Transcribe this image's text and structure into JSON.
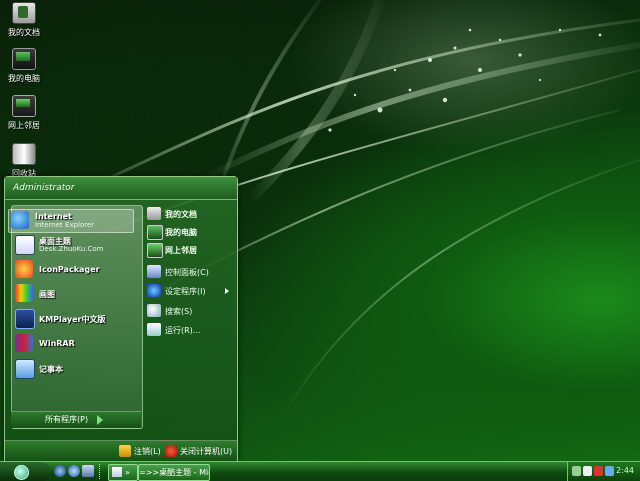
{
  "desktop": {
    "icons": [
      {
        "label": "我的文档",
        "icon": "my-documents-icon"
      },
      {
        "label": "我的电脑",
        "icon": "my-computer-icon"
      },
      {
        "label": "网上邻居",
        "icon": "network-places-icon"
      },
      {
        "label": "回收站",
        "icon": "recycle-bin-icon"
      }
    ]
  },
  "start_menu": {
    "user": "Administrator",
    "pinned": [
      {
        "title": "Internet",
        "subtitle": "Internet Explorer",
        "icon": "ie-icon"
      },
      {
        "title": "桌面主题",
        "subtitle": "Desk.ZhuoKu.Com",
        "icon": "desk-theme-icon"
      }
    ],
    "recent": [
      {
        "title": "IconPackager",
        "icon": "iconpackager-icon"
      },
      {
        "title": "画图",
        "icon": "paint-icon"
      },
      {
        "title": "KMPlayer中文版",
        "icon": "kmplayer-icon"
      },
      {
        "title": "WinRAR",
        "icon": "winrar-icon"
      },
      {
        "title": "记事本",
        "icon": "notepad-icon"
      }
    ],
    "all_programs": "所有程序(P)",
    "right": [
      {
        "label": "我的文档",
        "icon": "my-documents-icon"
      },
      {
        "label": "我的电脑",
        "icon": "my-computer-icon"
      },
      {
        "label": "网上邻居",
        "icon": "network-places-icon"
      },
      {
        "label": "控制面板(C)",
        "icon": "control-panel-icon"
      },
      {
        "label": "设定程序(I)",
        "icon": "default-programs-icon"
      },
      {
        "label": "搜索(S)",
        "icon": "search-icon"
      },
      {
        "label": "运行(R)...",
        "icon": "run-icon"
      }
    ],
    "logoff": "注销(L)",
    "shutdown": "关闭计算机(U)"
  },
  "taskbar": {
    "tasks": [
      {
        "label": "»"
      },
      {
        "label": "=>>桌酷主题 - Micr..."
      }
    ],
    "clock": "2:44"
  },
  "colors": {
    "accent": "#1f7a1f",
    "taskbar": "#0f4c10",
    "highlight": "#7fe07f"
  }
}
